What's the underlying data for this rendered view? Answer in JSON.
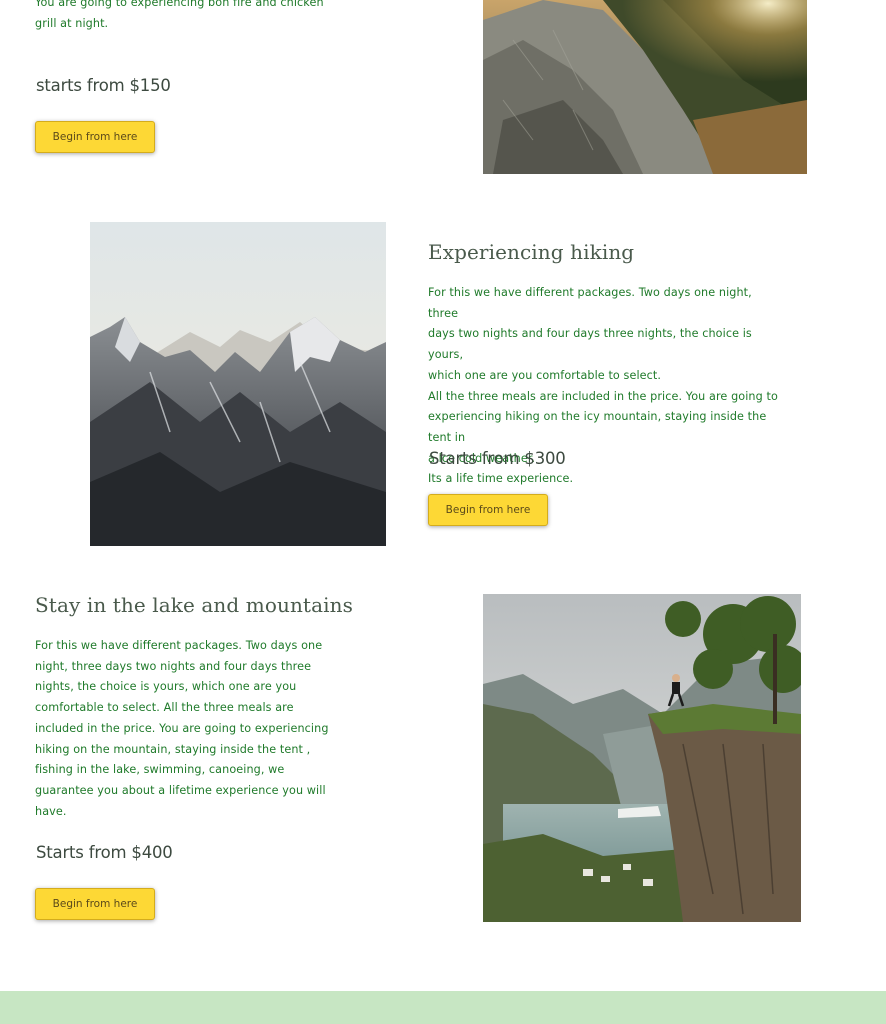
{
  "section1": {
    "text_partial": "You are going to experiencing bon fire and chicken\ngrill at night.",
    "price": "starts from $150",
    "button_label": "Begin from here",
    "image_icon": "mountain-sunset-photo"
  },
  "section2": {
    "title": "Experiencing hiking",
    "text": "For this we have different packages. Two days one night, three\ndays two nights and four days three nights, the choice is yours,\nwhich one are you comfortable to select.\nAll the three meals are included in the price. You are going to\nexperiencing hiking on the icy mountain, staying inside the tent in\na ice cold weather.\nIts a life time experience.",
    "price": "Starts from $300",
    "button_label": "Begin from here",
    "image_icon": "snowy-mountains-photo"
  },
  "section3": {
    "title": "Stay in the lake and mountains",
    "text": "For this we have different packages. Two days one\nnight, three days two nights and four days three\nnights, the choice is yours, which one are you\ncomfortable to select. All the three meals are\nincluded in the price. You are going to experiencing\nhiking on the  mountain, staying inside the tent ,\nfishing in the lake, swimming, canoeing, we\nguarantee you about a lifetime experience you will\nhave.",
    "price": "Starts from $400",
    "button_label": "Begin from here",
    "image_icon": "fjord-cliff-photo"
  },
  "colors": {
    "text_green": "#1f7a2a",
    "button_yellow": "#fdd835",
    "footer_green": "#c7e6c3"
  }
}
